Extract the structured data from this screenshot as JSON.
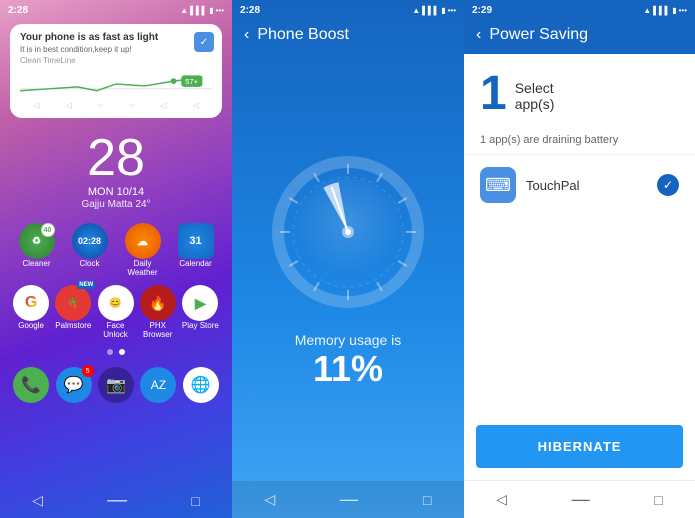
{
  "home": {
    "status_time": "2:28",
    "notif_title": "Your phone is as fast as light",
    "notif_sub": "It is in best condition,keep it up!",
    "notif_source": "Clean TimeLine",
    "date_num": "28",
    "day_line": "MON 10/14",
    "location": "Gajju Matta 24°",
    "apps_row1": [
      {
        "label": "Cleaner",
        "pct": "40%"
      },
      {
        "label": "Clock",
        "time": "02:28"
      },
      {
        "label": "Daily\nWeather"
      },
      {
        "label": "Calendar",
        "num": "31"
      }
    ],
    "apps_row2": [
      {
        "label": "Google"
      },
      {
        "label": "Palmstore"
      },
      {
        "label": "Face\nUnlock"
      },
      {
        "label": "PHX\nBrowser"
      },
      {
        "label": "Play Store"
      }
    ],
    "dock": [
      {
        "label": "Phone"
      },
      {
        "label": "Messages",
        "badge": "5"
      },
      {
        "label": "Camera"
      },
      {
        "label": "Translate"
      },
      {
        "label": "Chrome"
      }
    ]
  },
  "boost": {
    "status_time": "2:28",
    "header_title": "Phone Boost",
    "memory_label": "Memory usage is",
    "memory_value": "11%",
    "nav_back": "‹",
    "nav_home": "—",
    "nav_square": "□"
  },
  "power": {
    "status_time": "2:29",
    "header_title": "Power Saving",
    "step_num": "1",
    "step_label": "Select\napp(s)",
    "drain_text": "1 app(s) are draining battery",
    "app_name": "TouchPal",
    "hibernate_label": "HIBERNATE",
    "nav_back": "‹",
    "nav_home": "—",
    "nav_square": "□"
  }
}
